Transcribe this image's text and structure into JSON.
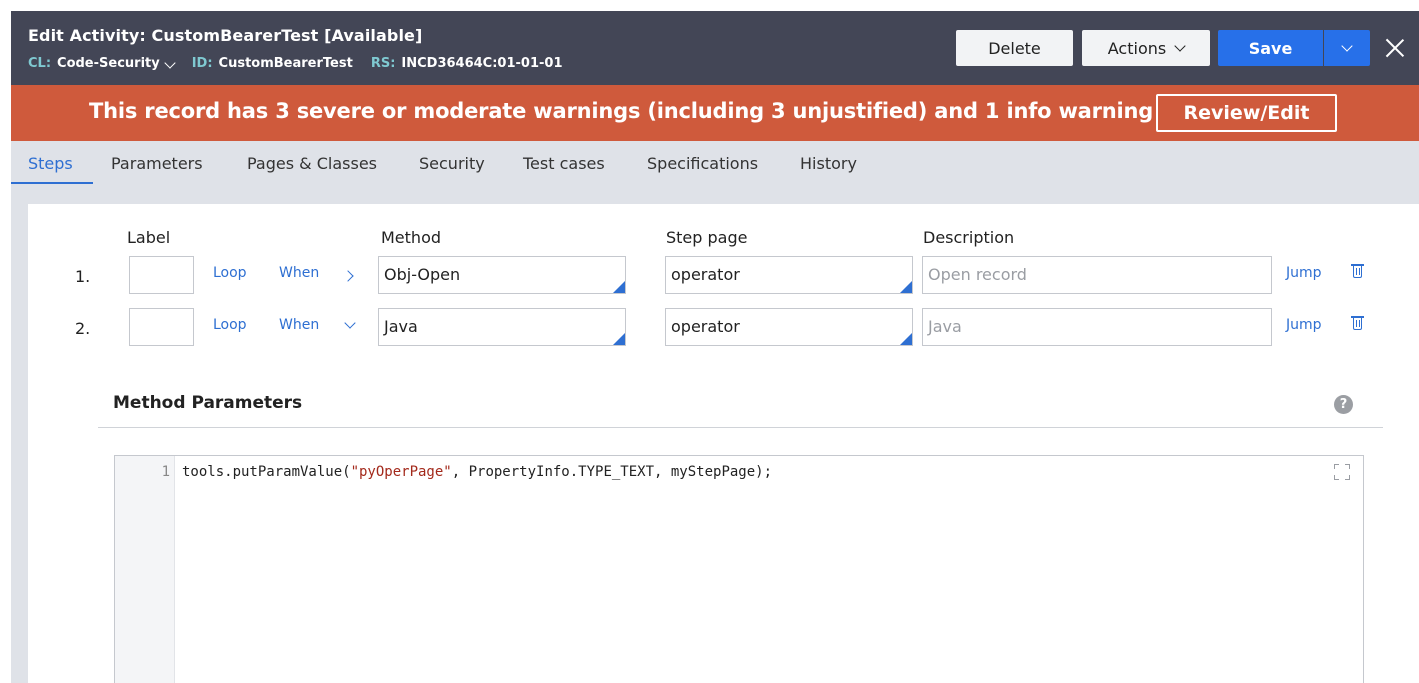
{
  "header": {
    "title": "Edit  Activity: CustomBearerTest [Available]",
    "cl_key": "CL:",
    "cl_value": "Code-Security",
    "id_key": "ID:",
    "id_value": "CustomBearerTest",
    "rs_key": "RS:",
    "rs_value": "INCD36464C:01-01-01",
    "delete_label": "Delete",
    "actions_label": "Actions",
    "save_label": "Save"
  },
  "banner": {
    "text": "This record has 3 severe or moderate warnings (including 3 unjustified) and 1 info warning",
    "review_label": "Review/Edit",
    "color": "#cf5a3c"
  },
  "tabs": [
    {
      "label": "Steps",
      "active": true
    },
    {
      "label": "Parameters"
    },
    {
      "label": "Pages & Classes"
    },
    {
      "label": "Security"
    },
    {
      "label": "Test cases"
    },
    {
      "label": "Specifications"
    },
    {
      "label": "History"
    }
  ],
  "columns": {
    "label": "Label",
    "method": "Method",
    "step_page": "Step page",
    "description": "Description"
  },
  "steps": [
    {
      "num": "1.",
      "label": "",
      "loop": "Loop",
      "when": "When",
      "method": "Obj-Open",
      "step_page": "operator",
      "description_placeholder": "Open record",
      "jump": "Jump",
      "expanded": false
    },
    {
      "num": "2.",
      "label": "",
      "loop": "Loop",
      "when": "When",
      "method": "Java",
      "step_page": "operator",
      "description_placeholder": "Java",
      "jump": "Jump",
      "expanded": true
    }
  ],
  "method_parameters": {
    "title": "Method Parameters",
    "help_glyph": "?",
    "line_number": "1",
    "code_pre": "tools.putParamValue(",
    "code_string": "\"pyOperPage\"",
    "code_post": ", PropertyInfo.TYPE_TEXT, myStepPage);"
  },
  "colors": {
    "header_bg": "#434656",
    "accent_blue": "#2770e9",
    "meta_key": "#7fc9d1"
  }
}
